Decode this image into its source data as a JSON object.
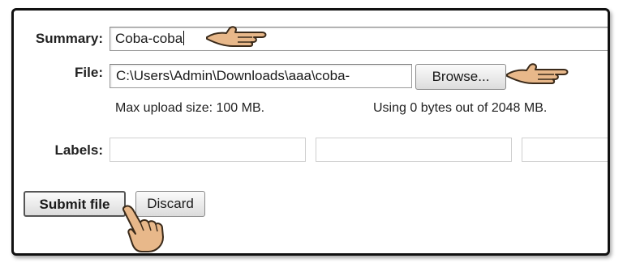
{
  "form": {
    "summary_label": "Summary:",
    "summary_value": "Coba-coba",
    "file_label": "File:",
    "file_value": "C:\\Users\\Admin\\Downloads\\aaa\\coba-",
    "browse_label": "Browse...",
    "max_upload": "Max upload size: 100 MB.",
    "usage": "Using 0 bytes out of 2048 MB.",
    "labels_label": "Labels:",
    "label_inputs": [
      "",
      "",
      ""
    ],
    "submit_label": "Submit file",
    "discard_label": "Discard"
  },
  "icons": [
    "pointing-hand-icon"
  ]
}
